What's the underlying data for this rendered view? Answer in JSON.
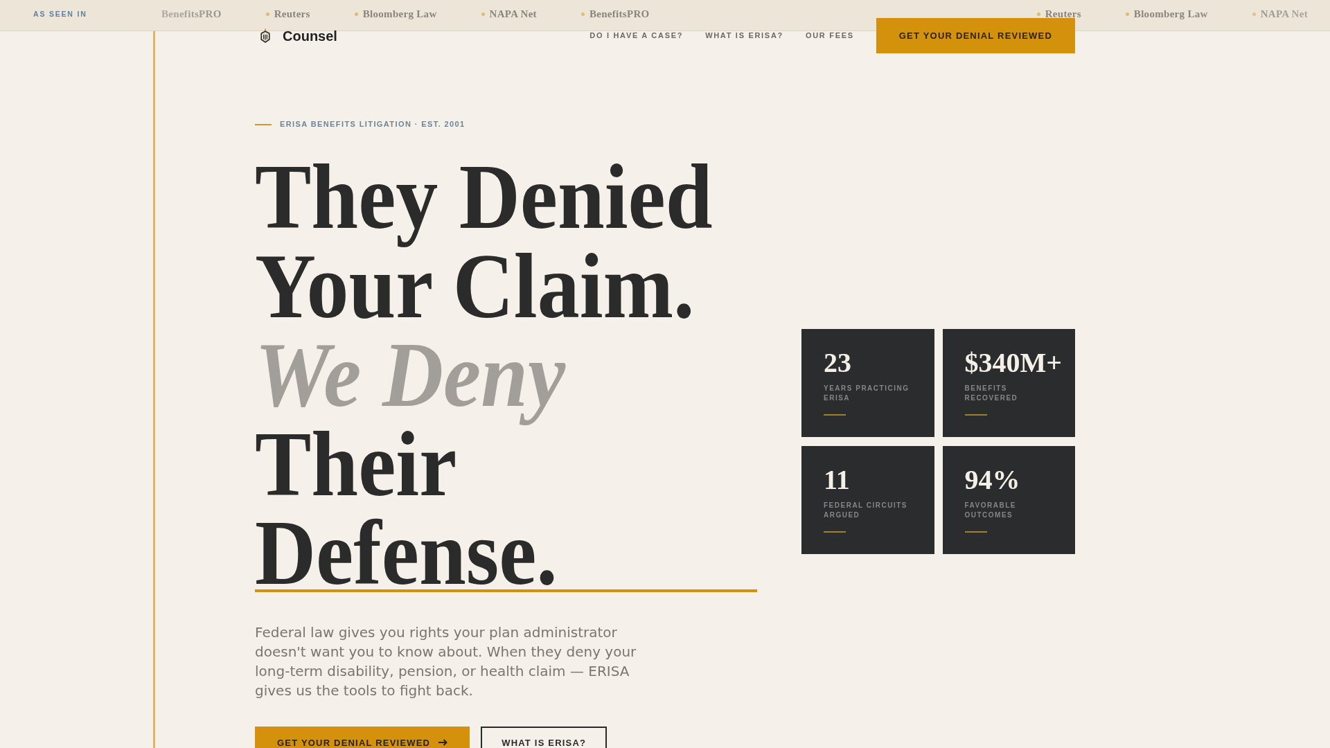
{
  "press_bar": {
    "label": "AS SEEN IN",
    "groups": [
      {
        "items": [
          "BenefitsPRO",
          "Reuters",
          "Bloomberg Law",
          "NAPA Net",
          "BenefitsPRO"
        ]
      },
      {
        "items": [
          "Reuters",
          "Bloomberg Law",
          "NAPA Net"
        ]
      }
    ]
  },
  "header": {
    "brand": "Counsel",
    "nav": [
      {
        "label": "DO I HAVE A CASE?"
      },
      {
        "label": "WHAT IS ERISA?"
      },
      {
        "label": "OUR FEES"
      }
    ],
    "cta": "GET YOUR DENIAL REVIEWED"
  },
  "hero": {
    "eyebrow": "ERISA BENEFITS LITIGATION · EST. 2001",
    "headline": "They Denied Your Claim. *We Deny* Their Defense.",
    "intro": "Federal law gives you rights your plan administrator doesn't want you to know about. When they deny your long-term disability, pension, or health claim — ERISA gives us the tools to fight back.",
    "buttons": [
      {
        "label": "GET YOUR DENIAL REVIEWED",
        "kind": "primary"
      },
      {
        "label": "WHAT IS ERISA?",
        "kind": "secondary"
      }
    ]
  },
  "stats": [
    {
      "value": "23",
      "label": "YEARS PRACTICING ERISA"
    },
    {
      "value": "$340M+",
      "label": "BENEFITS RECOVERED"
    },
    {
      "value": "11",
      "label": "FEDERAL CIRCUITS ARGUED"
    },
    {
      "value": "94%",
      "label": "FAVORABLE OUTCOMES"
    }
  ]
}
